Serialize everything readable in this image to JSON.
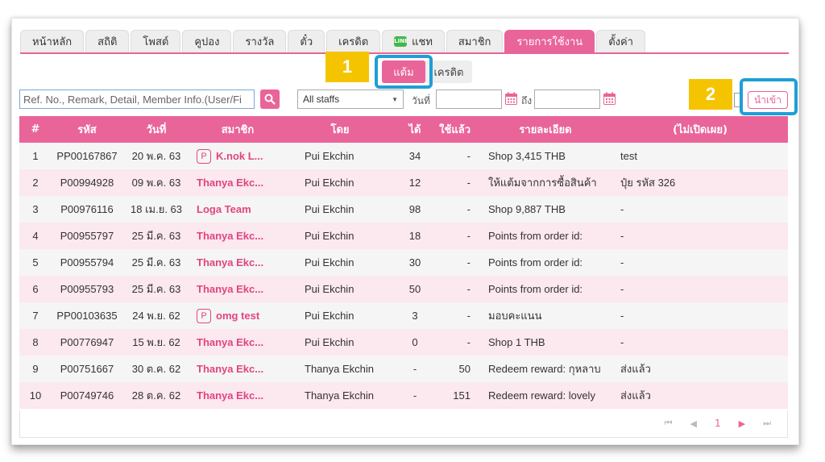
{
  "tabs": [
    {
      "label": "หน้าหลัก",
      "active": false
    },
    {
      "label": "สถิติ",
      "active": false
    },
    {
      "label": "โพสต์",
      "active": false
    },
    {
      "label": "คูปอง",
      "active": false
    },
    {
      "label": "รางวัล",
      "active": false
    },
    {
      "label": "ตั๋ว",
      "active": false
    },
    {
      "label": "เครดิต",
      "active": false
    },
    {
      "label": "แชท",
      "active": false,
      "icon": "line-chat-icon",
      "icon_text": "LINE"
    },
    {
      "label": "สมาชิก",
      "active": false
    },
    {
      "label": "รายการใช้งาน",
      "active": true
    },
    {
      "label": "ตั้งค่า",
      "active": false
    }
  ],
  "subtabs": {
    "points": "แต้ม",
    "credit": "เครดิต"
  },
  "callouts": {
    "one": "1",
    "two": "2"
  },
  "filters": {
    "search_placeholder": "Ref. No., Remark, Detail, Member Info.(User/Fi",
    "staff_selected": "All staffs",
    "date_label": "วันที่",
    "to_label": "ถึง",
    "import_label": "นำเข้า"
  },
  "table": {
    "headers": [
      "#",
      "รหัส",
      "วันที่",
      "สมาชิก",
      "โดย",
      "ได้",
      "ใช้แล้ว",
      "รายละเอียด",
      "(ไม่เปิดเผย)"
    ],
    "rows": [
      {
        "num": "1",
        "code": "PP00167867",
        "date": "20 พ.ค. 63",
        "member": "K.nok L...",
        "badge": "P",
        "by": "Pui Ekchin",
        "got": "34",
        "used": "-",
        "detail": "Shop 3,415 THB",
        "private": "test"
      },
      {
        "num": "2",
        "code": "P00994928",
        "date": "09 พ.ค. 63",
        "member": "Thanya Ekc...",
        "badge": "",
        "by": "Pui Ekchin",
        "got": "12",
        "used": "-",
        "detail": "ให้แต้มจากการซื้อสินค้า",
        "private": "ปุ๋ย รหัส 326"
      },
      {
        "num": "3",
        "code": "P00976116",
        "date": "18 เม.ย. 63",
        "member": "Loga Team",
        "badge": "",
        "by": "Pui Ekchin",
        "got": "98",
        "used": "-",
        "detail": "Shop 9,887 THB",
        "private": "-"
      },
      {
        "num": "4",
        "code": "P00955797",
        "date": "25 มี.ค. 63",
        "member": "Thanya Ekc...",
        "badge": "",
        "by": "Pui Ekchin",
        "got": "18",
        "used": "-",
        "detail": "Points from order id:",
        "private": "-"
      },
      {
        "num": "5",
        "code": "P00955794",
        "date": "25 มี.ค. 63",
        "member": "Thanya Ekc...",
        "badge": "",
        "by": "Pui Ekchin",
        "got": "30",
        "used": "-",
        "detail": "Points from order id:",
        "private": "-"
      },
      {
        "num": "6",
        "code": "P00955793",
        "date": "25 มี.ค. 63",
        "member": "Thanya Ekc...",
        "badge": "",
        "by": "Pui Ekchin",
        "got": "50",
        "used": "-",
        "detail": "Points from order id:",
        "private": "-"
      },
      {
        "num": "7",
        "code": "PP00103635",
        "date": "24 พ.ย. 62",
        "member": "omg test",
        "badge": "P",
        "by": "Pui Ekchin",
        "got": "3",
        "used": "-",
        "detail": "มอบคะแนน",
        "private": "-"
      },
      {
        "num": "8",
        "code": "P00776947",
        "date": "15 พ.ย. 62",
        "member": "Thanya Ekc...",
        "badge": "",
        "by": "Pui Ekchin",
        "got": "0",
        "used": "-",
        "detail": "Shop 1 THB",
        "private": "-"
      },
      {
        "num": "9",
        "code": "P00751667",
        "date": "30 ต.ค. 62",
        "member": "Thanya Ekc...",
        "badge": "",
        "by": "Thanya Ekchin",
        "got": "-",
        "used": "50",
        "detail": "Redeem reward: กุหลาบ",
        "private": "ส่งแล้ว"
      },
      {
        "num": "10",
        "code": "P00749746",
        "date": "28 ต.ค. 62",
        "member": "Thanya Ekc...",
        "badge": "",
        "by": "Thanya Ekchin",
        "got": "-",
        "used": "151",
        "detail": "Redeem reward: lovely",
        "private": "ส่งแล้ว"
      }
    ]
  },
  "pager": {
    "first": "⏮",
    "prev": "◀",
    "current": "1",
    "next": "▶",
    "last": "⏭"
  },
  "colors": {
    "accent": "#e96499",
    "callout": "#f5c400",
    "highlight": "#1e9fd6",
    "line": "#41b84a"
  }
}
